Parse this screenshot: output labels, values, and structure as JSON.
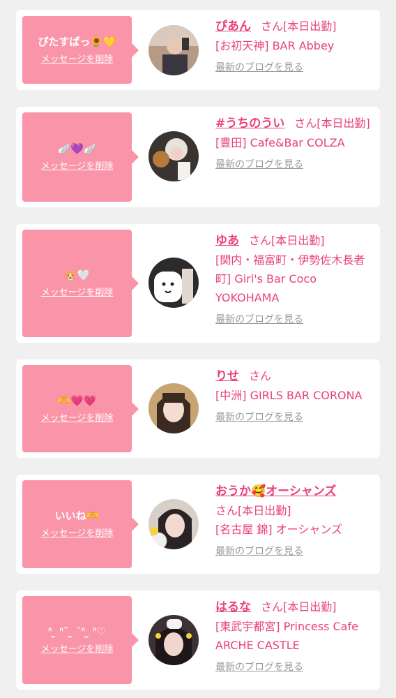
{
  "colors": {
    "page_background": "#f0f0f0",
    "card_background": "#ffffff",
    "bubble": "#fa94a8",
    "accent": "#ea3f7c",
    "link_gray": "#999999"
  },
  "labels": {
    "delete_message": "メッセージを削除",
    "view_blog": "最新のブログを見る",
    "san": "さん"
  },
  "items": [
    {
      "message": "ぴたすぱっ🌻💛",
      "name": "ぴあん",
      "status": "[本日出勤]",
      "shop": "[お初天神] BAR Abbey",
      "avatar_icon": "avatar-photo"
    },
    {
      "message": "🪽💜🪽",
      "name": "#うちのうい",
      "status": "[本日出勤]",
      "shop": "[豊田] Cafe&Bar COLZA",
      "avatar_icon": "avatar-photo"
    },
    {
      "message": "🐹🤍",
      "name": "ゆあ",
      "status": "[本日出勤]",
      "shop": "[関内・福富町・伊勢佐木長者町] Girl's Bar Coco YOKOHAMA",
      "avatar_icon": "avatar-photo"
    },
    {
      "message": "🫶💗💗",
      "name": "りせ",
      "status": "",
      "shop": "[中洲] GIRLS BAR CORONA",
      "avatar_icon": "avatar-photo"
    },
    {
      "message": "いいね🫶",
      "name": "おうか🥰オーシャンズ",
      "status": "[本日出勤]",
      "shop": "[名古屋 錦] オーシャンズ",
      "avatar_icon": "avatar-photo"
    },
    {
      "message": "ᐢ ̫ ᐢ˘ ̫ ˘ᐢ ̫ ᐢ♡",
      "name": "はるな",
      "status": "[本日出勤]",
      "shop": "[東武宇都宮] Princess Cafe ARCHE CASTLE",
      "avatar_icon": "avatar-photo"
    }
  ]
}
